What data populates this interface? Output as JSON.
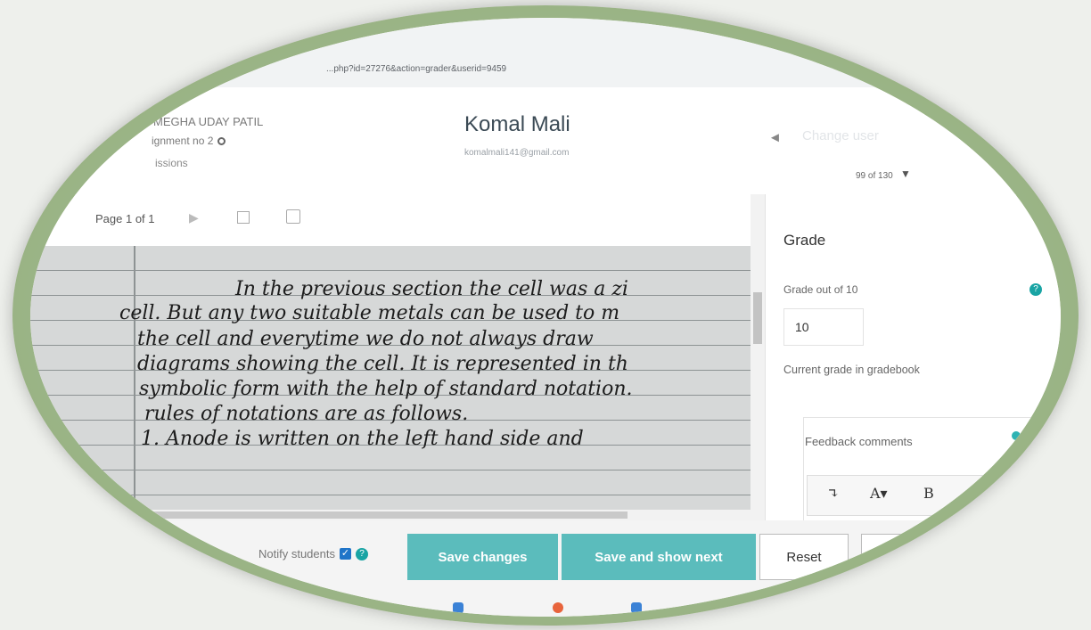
{
  "browser": {
    "url": "...php?id=27276&action=grader&userid=9459"
  },
  "header": {
    "course": "MEGHA UDAY PATIL",
    "assignment": "ignment no 2",
    "submissions": "issions",
    "student_name": "Komal Mali",
    "student_email": "komalmali141@gmail.com",
    "change_user": "Change user",
    "count": "99 of 130"
  },
  "toolbar": {
    "page_label": "Page 1 of 1"
  },
  "document": {
    "lines": [
      "In the previous section the cell was a zi",
      "cell. But any two suitable metals can be used to m",
      "the cell and everytime we do not always draw",
      "diagrams showing the cell. It is represented in th",
      "symbolic form with the help of standard notation.",
      "rules of notations are as follows.",
      "1. Anode is written on the left hand side and"
    ]
  },
  "panel": {
    "grade_title": "Grade",
    "grade_out_of": "Grade out of 10",
    "grade_value": "10",
    "current_grade": "Current grade in gradebook",
    "feedback_label": "Feedback comments",
    "editor": {
      "btn1": "↴",
      "btn2": "A▾",
      "btn3": "B"
    }
  },
  "footer": {
    "notify": "Notify students",
    "save_changes": "Save changes",
    "save_and_show_next": "Save and show next",
    "reset": "Reset"
  },
  "colors": {
    "accent": "#5bbcbc",
    "checkbox": "#1f74c8",
    "help": "#19a4a4"
  }
}
